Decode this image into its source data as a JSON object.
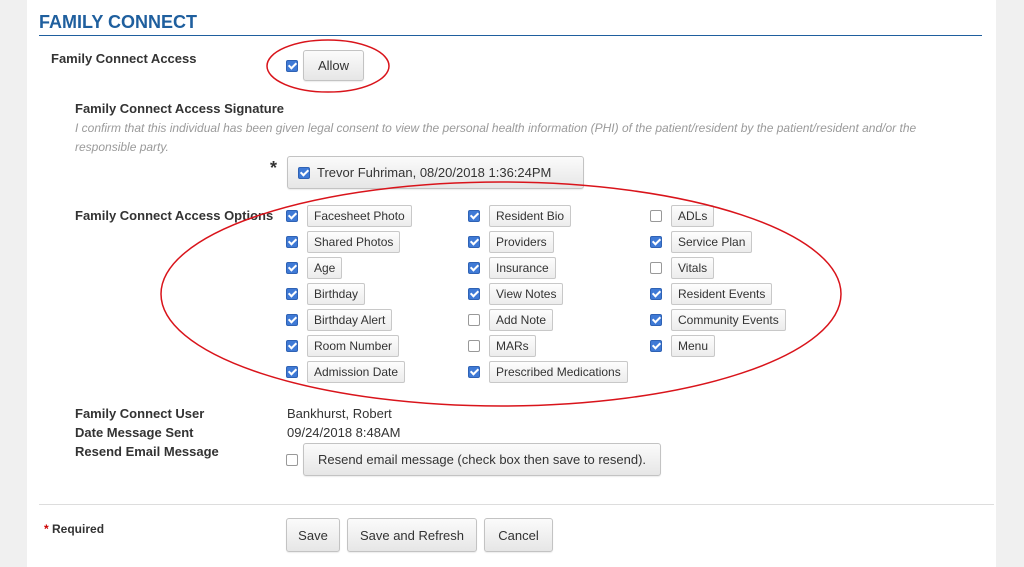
{
  "section_title": "FAMILY CONNECT",
  "access": {
    "label": "Family Connect Access",
    "checked": true,
    "button_label": "Allow"
  },
  "signature": {
    "label": "Family Connect Access Signature",
    "description": "I confirm that this individual has been given legal consent to view the personal health information (PHI) of the patient/resident by the patient/resident and/or the responsible party.",
    "required_marker": "*",
    "checked": true,
    "button_label": "Trevor Fuhriman, 08/20/2018 1:36:24PM"
  },
  "options": {
    "label": "Family Connect Access Options",
    "columns": [
      [
        {
          "label": "Facesheet Photo",
          "checked": true
        },
        {
          "label": "Shared Photos",
          "checked": true
        },
        {
          "label": "Age",
          "checked": true
        },
        {
          "label": "Birthday",
          "checked": true
        },
        {
          "label": "Birthday Alert",
          "checked": true
        },
        {
          "label": "Room Number",
          "checked": true
        },
        {
          "label": "Admission Date",
          "checked": true
        }
      ],
      [
        {
          "label": "Resident Bio",
          "checked": true
        },
        {
          "label": "Providers",
          "checked": true
        },
        {
          "label": "Insurance",
          "checked": true
        },
        {
          "label": "View Notes",
          "checked": true
        },
        {
          "label": "Add Note",
          "checked": false
        },
        {
          "label": "MARs",
          "checked": false
        },
        {
          "label": "Prescribed Medications",
          "checked": true
        }
      ],
      [
        {
          "label": "ADLs",
          "checked": false
        },
        {
          "label": "Service Plan",
          "checked": true
        },
        {
          "label": "Vitals",
          "checked": false
        },
        {
          "label": "Resident Events",
          "checked": true
        },
        {
          "label": "Community Events",
          "checked": true
        },
        {
          "label": "Menu",
          "checked": true
        }
      ]
    ]
  },
  "user": {
    "label": "Family Connect User",
    "value": "Bankhurst, Robert"
  },
  "date_sent": {
    "label": "Date Message Sent",
    "value": "09/24/2018 8:48AM"
  },
  "resend": {
    "label": "Resend Email Message",
    "checked": false,
    "button_label": "Resend email message (check box then save to resend)."
  },
  "footer": {
    "required_star": "*",
    "required_label": "Required",
    "save_label": "Save",
    "save_refresh_label": "Save and Refresh",
    "cancel_label": "Cancel"
  },
  "annotation_color": "#d9141b"
}
